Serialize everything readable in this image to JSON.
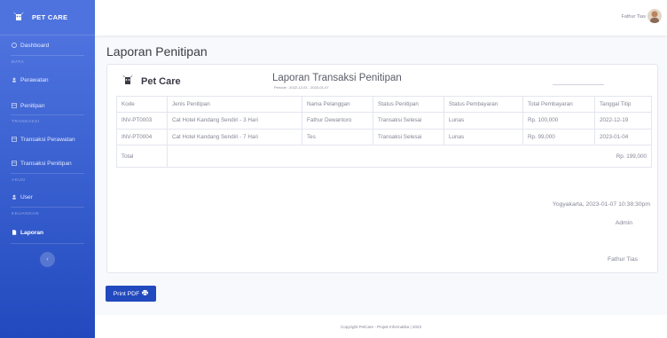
{
  "sidebar": {
    "brand": "PET CARE",
    "items": [
      {
        "label": "Dashboard"
      },
      {
        "heading": "DATA"
      },
      {
        "label": "Perawatan"
      },
      {
        "label": "Penitipan"
      },
      {
        "heading": "TRANSAKSI"
      },
      {
        "label": "Transaksi Perawatan"
      },
      {
        "label": "Transaksi Penitipan"
      },
      {
        "heading": "AKUN"
      },
      {
        "label": "User"
      },
      {
        "heading": "KEUANGAN"
      },
      {
        "label": "Laporan"
      }
    ],
    "toggle_glyph": "‹"
  },
  "topbar": {
    "user_name": "Fathur Tias"
  },
  "page": {
    "title": "Laporan Penitipan"
  },
  "report": {
    "logo_text": "Pet Care",
    "title": "Laporan Transaksi Penitipan",
    "period": "Periode : 2022-12-01 - 2023-01-07",
    "columns": [
      "Kode",
      "Jenis Penitipan",
      "Nama Pelanggan",
      "Status Penitipan",
      "Status Pembayaran",
      "Total Pembayaran",
      "Tanggal Titip"
    ],
    "rows": [
      [
        "INV-PT0003",
        "Cat Hotel Kandang Sendiri - 3 Hari",
        "Fathur Dewantoro",
        "Transaksi Selesai",
        "Lunas",
        "Rp. 100,000",
        "2022-12-19"
      ],
      [
        "INV-PT0004",
        "Cat Hotel Kandang Sendiri - 7 Hari",
        "Tes",
        "Transaksi Selesai",
        "Lunas",
        "Rp. 99,000",
        "2023-01-04"
      ]
    ],
    "total_label": "Total",
    "total_value": "Rp. 199,000",
    "place_date": "Yogyakarta,  2023-01-07 10:38:30pm",
    "signer_role": "Admin",
    "signer_name": "Fathur Tias"
  },
  "actions": {
    "print_label": "Print PDF"
  },
  "footer": {
    "text": "Copyright  PetCare - Projek Informatika | 2023"
  },
  "colors": {
    "sidebar_top": "#4e73df",
    "sidebar_bottom": "#224abe",
    "button": "#224abe"
  }
}
